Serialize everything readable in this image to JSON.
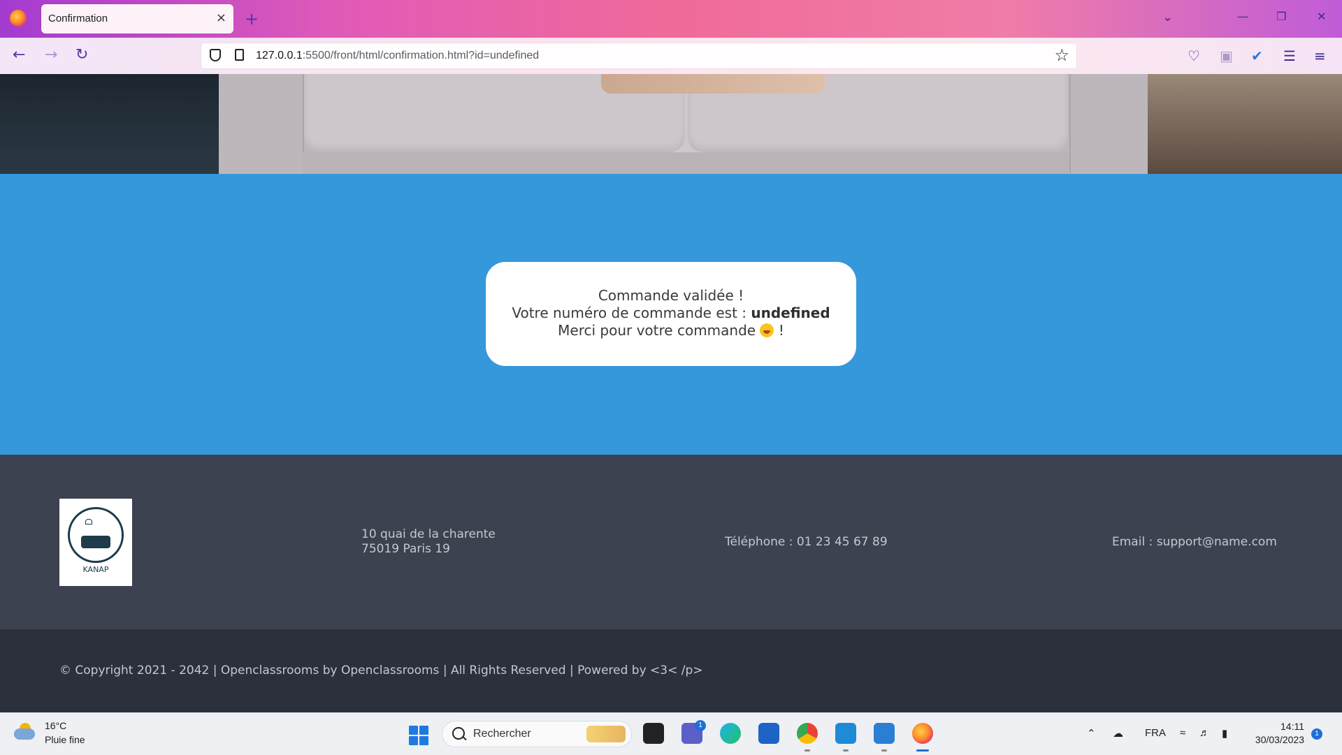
{
  "browser": {
    "tab_title": "Confirmation",
    "tab_close": "×",
    "new_tab": "+",
    "url_host": "127.0.0.1",
    "url_path": ":5500/front/html/confirmation.html?id=undefined"
  },
  "confirmation": {
    "line1": "Commande validée !",
    "line2_prefix": "Votre numéro de commande est : ",
    "order_id": "undefined",
    "line3_prefix": "Merci pour votre commande",
    "line3_suffix": "!"
  },
  "footer": {
    "logo_text": "KANAP",
    "address_line1": "10 quai de la charente",
    "address_line2": "75019 Paris 19",
    "phone": "Téléphone : 01 23 45 67 89",
    "email": "Email : support@name.com",
    "copyright": "© Copyright 2021 - 2042 | Openclassrooms by Openclassrooms | All Rights Reserved | Powered by <3< /p>"
  },
  "taskbar": {
    "weather_temp": "16°C",
    "weather_desc": "Pluie fine",
    "search_placeholder": "Rechercher",
    "teams_badge": "1",
    "language": "FRA",
    "time": "14:11",
    "date": "30/03/2023",
    "notification_count": "1"
  },
  "colors": {
    "main_band": "#3498db",
    "footer_top": "#3d4250",
    "footer_bottom": "#2c2f3c"
  }
}
